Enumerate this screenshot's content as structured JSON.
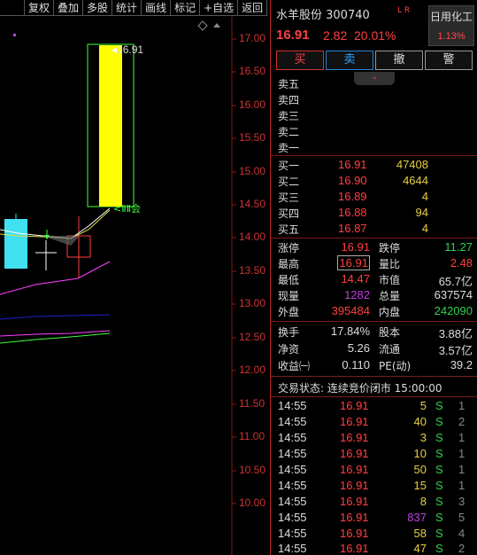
{
  "toolbar": [
    "复权",
    "叠加",
    "多股",
    "统计",
    "画线",
    "标记",
    "+自选",
    "返回"
  ],
  "chart": {
    "price_axis": [
      "17.00",
      "16.50",
      "16.00",
      "15.50",
      "15.00",
      "14.50",
      "14.00",
      "13.50",
      "13.00",
      "12.50",
      "12.00",
      "11.50",
      "11.00",
      "10.50",
      "10.00"
    ],
    "high_label": "16.91",
    "volume_tag": "ⒸⒷ会",
    "colors": {
      "up": "#ffff00",
      "down": "#40e0f0",
      "grid": "#8a1a1a",
      "ma5": "#ffffff",
      "ma10": "#e0e040",
      "ma20": "#ff40ff",
      "ma60": "#2020d0",
      "ma120": "#40ff40"
    }
  },
  "header": {
    "name": "水羊股份 300740",
    "lr": "L R",
    "price": "16.91",
    "change": "2.82",
    "pct": "20.01%",
    "sector": "日用化工",
    "sector_pct": "1.13%"
  },
  "buttons": {
    "buy": "买",
    "sell": "卖",
    "cancel": "撤",
    "alert": "警"
  },
  "asks": [
    "卖五",
    "卖四",
    "卖三",
    "卖二",
    "卖一"
  ],
  "bids": [
    {
      "label": "买一",
      "price": "16.91",
      "vol": "47408"
    },
    {
      "label": "买二",
      "price": "16.90",
      "vol": "4644"
    },
    {
      "label": "买三",
      "price": "16.89",
      "vol": "4"
    },
    {
      "label": "买四",
      "price": "16.88",
      "vol": "94"
    },
    {
      "label": "买五",
      "price": "16.87",
      "vol": "4"
    }
  ],
  "stats1": [
    {
      "l1": "涨停",
      "v1": "16.91",
      "c1": "red",
      "l2": "跌停",
      "v2": "11.27",
      "c2": "grn"
    },
    {
      "l1": "最高",
      "v1": "16.91",
      "c1": "red",
      "l2": "量比",
      "v2": "2.48",
      "c2": "red"
    },
    {
      "l1": "最低",
      "v1": "14.47",
      "c1": "red",
      "l2": "市值",
      "v2": "65.7亿",
      "c2": "wht"
    },
    {
      "l1": "现量",
      "v1": "1282",
      "c1": "pur",
      "l2": "总量",
      "v2": "637574",
      "c2": "wht"
    },
    {
      "l1": "外盘",
      "v1": "395484",
      "c1": "red",
      "l2": "内盘",
      "v2": "242090",
      "c2": "grn"
    }
  ],
  "stats2": [
    {
      "l1": "换手",
      "v1": "17.84%",
      "l2": "股本",
      "v2": "3.88亿"
    },
    {
      "l1": "净资",
      "v1": "5.26",
      "l2": "流通",
      "v2": "3.57亿"
    },
    {
      "l1": "收益㈠",
      "v1": "0.110",
      "l2": "PE(动)",
      "v2": "39.2"
    }
  ],
  "trade_status": "交易状态: 连续竞价闭市 15:00:00",
  "ticks": [
    {
      "t": "14:55",
      "p": "16.91",
      "v": "5",
      "c": "yel",
      "s": "S",
      "n": "1"
    },
    {
      "t": "14:55",
      "p": "16.91",
      "v": "40",
      "c": "yel",
      "s": "S",
      "n": "2"
    },
    {
      "t": "14:55",
      "p": "16.91",
      "v": "3",
      "c": "yel",
      "s": "S",
      "n": "1"
    },
    {
      "t": "14:55",
      "p": "16.91",
      "v": "10",
      "c": "yel",
      "s": "S",
      "n": "1"
    },
    {
      "t": "14:55",
      "p": "16.91",
      "v": "50",
      "c": "yel",
      "s": "S",
      "n": "1"
    },
    {
      "t": "14:55",
      "p": "16.91",
      "v": "15",
      "c": "yel",
      "s": "S",
      "n": "1"
    },
    {
      "t": "14:55",
      "p": "16.91",
      "v": "8",
      "c": "yel",
      "s": "S",
      "n": "3"
    },
    {
      "t": "14:55",
      "p": "16.91",
      "v": "837",
      "c": "pur",
      "s": "S",
      "n": "5"
    },
    {
      "t": "14:55",
      "p": "16.91",
      "v": "58",
      "c": "yel",
      "s": "S",
      "n": "4"
    },
    {
      "t": "14:55",
      "p": "16.91",
      "v": "47",
      "c": "yel",
      "s": "S",
      "n": "2"
    }
  ]
}
